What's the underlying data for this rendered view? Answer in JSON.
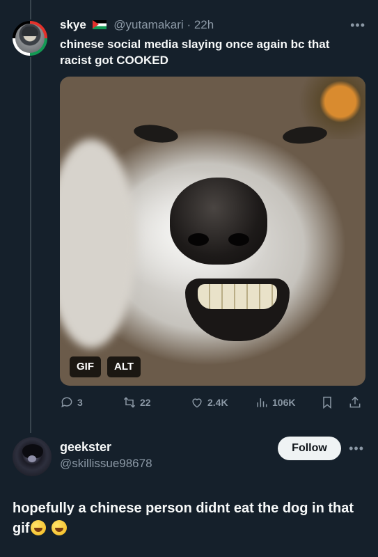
{
  "tweet": {
    "display_name": "skye",
    "handle": "@yutamakari",
    "separator": "·",
    "time": "22h",
    "text": "chinese social media slaying once again bc that racist got COOKED",
    "media_badges": {
      "gif": "GIF",
      "alt": "ALT"
    },
    "stats": {
      "replies": "3",
      "reposts": "22",
      "likes": "2.4K",
      "views": "106K"
    }
  },
  "reply": {
    "display_name": "geekster",
    "handle": "@skillissue98678",
    "follow_label": "Follow",
    "text": "hopefully a chinese person didnt eat the dog in that gif",
    "emojis": [
      "rolling-on-floor-laughing-emoji",
      "rolling-on-floor-laughing-emoji"
    ]
  },
  "colors": {
    "background": "#15202b",
    "text": "#f7f9f9",
    "muted": "#8b98a5",
    "follow_bg": "#eff3f4"
  }
}
